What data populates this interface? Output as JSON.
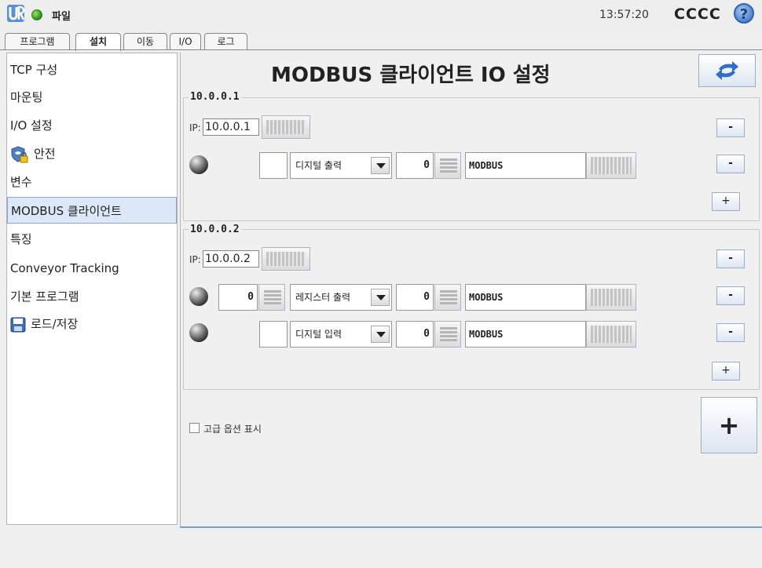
{
  "header": {
    "file_menu": "파일",
    "clock": "13:57:20",
    "robot_name": "CCCC",
    "help": "?"
  },
  "tabs": [
    {
      "label": "프로그램"
    },
    {
      "label": "설치",
      "active": true
    },
    {
      "label": "이동"
    },
    {
      "label": "I/O"
    },
    {
      "label": "로그"
    }
  ],
  "sidebar": {
    "items": [
      {
        "label": "TCP 구성"
      },
      {
        "label": "마운팅"
      },
      {
        "label": "I/O 설정"
      },
      {
        "label": "안전",
        "icon": "shield-lock-icon"
      },
      {
        "label": "변수"
      },
      {
        "label": "MODBUS 클라이언트",
        "selected": true
      },
      {
        "label": "특징"
      },
      {
        "label": "Conveyor Tracking"
      },
      {
        "label": "기본 프로그램"
      },
      {
        "label": "로드/저장",
        "icon": "floppy-disk-icon"
      }
    ]
  },
  "main": {
    "title": "MODBUS 클라이언트 IO 설정",
    "advanced_label": "고급 옵션 표시",
    "advanced_checked": false,
    "plus": "+",
    "minus": "-",
    "groups": [
      {
        "title": "10.0.0.1",
        "ip_label": "IP:",
        "ip_value": "10.0.0.1",
        "signals": [
          {
            "type": "디지털 출력",
            "address": "0",
            "name": "MODBUS"
          }
        ]
      },
      {
        "title": "10.0.0.2",
        "ip_label": "IP:",
        "ip_value": "10.0.0.2",
        "signals": [
          {
            "value": "0",
            "type": "레지스터 출력",
            "address": "0",
            "name": "MODBUS"
          },
          {
            "type": "디지털 입력",
            "address": "0",
            "name": "MODBUS"
          }
        ]
      }
    ]
  },
  "colors": {
    "accent": "#4f86d1",
    "selected_bg": "#dce8f7",
    "status_green": "#2e9e1a"
  }
}
